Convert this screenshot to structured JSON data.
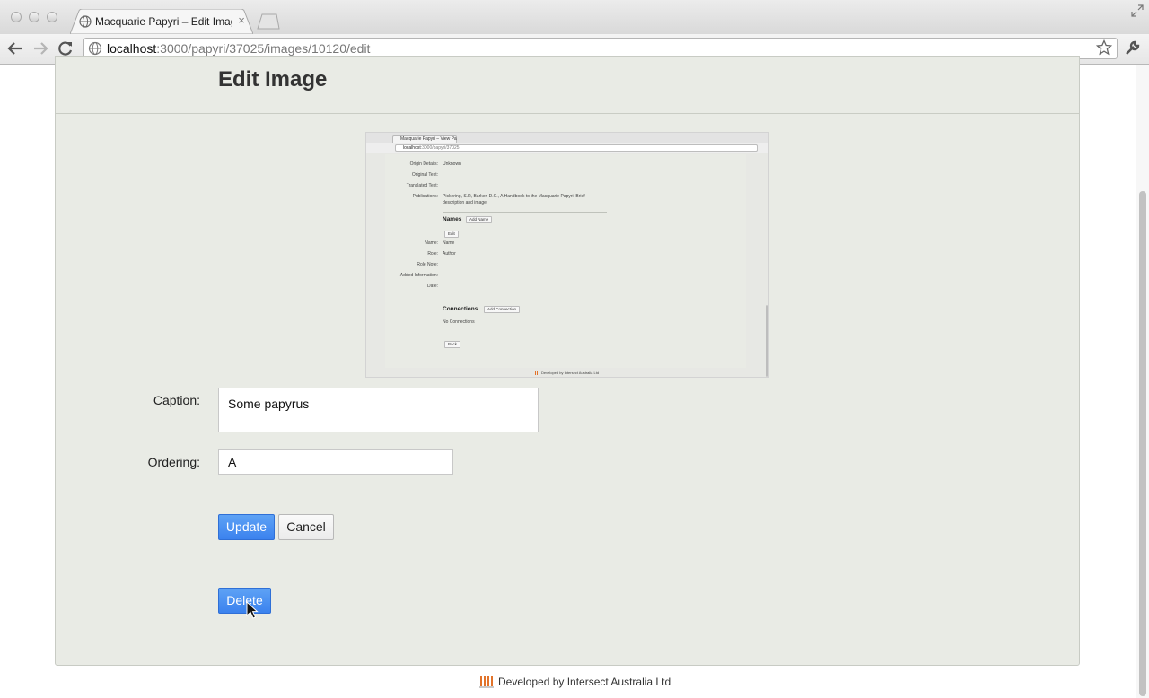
{
  "browser": {
    "tab_title": "Macquarie Papyri – Edit Imag",
    "tab_close": "×",
    "url_host": "localhost",
    "url_path": ":3000/papyri/37025/images/10120/edit"
  },
  "page": {
    "title": "Edit Image"
  },
  "image_preview": {
    "tab_title": "Macquarie Papyri – View Pa",
    "url_host": "localhost",
    "url_path": ":3000/papyri/37025",
    "fields": [
      {
        "label": "Origin Details:",
        "value": "Unknown"
      },
      {
        "label": "Original Text:",
        "value": ""
      },
      {
        "label": "Translated Text:",
        "value": ""
      },
      {
        "label": "Publications:",
        "value": "Pickering, S.R, Barker, D.C., A Handbook to the Macquarie Papyri. Brief"
      },
      {
        "label": "",
        "value": "description and image."
      }
    ],
    "names_heading": "Names",
    "add_name": "Add Name",
    "edit": "Edit",
    "name_fields": [
      {
        "label": "Name:",
        "value": "Name"
      },
      {
        "label": "Role:",
        "value": "Author"
      },
      {
        "label": "Role Note:",
        "value": ""
      },
      {
        "label": "Added Information:",
        "value": ""
      },
      {
        "label": "Date:",
        "value": ""
      }
    ],
    "connections_heading": "Connections",
    "add_connection": "Add Connection",
    "no_connections": "No Connections",
    "back": "Back",
    "footer": "Developed by Intersect Australia Ltd"
  },
  "form": {
    "caption_label": "Caption:",
    "caption_value": "Some papyrus",
    "ordering_label": "Ordering:",
    "ordering_value": "A",
    "update_label": "Update",
    "cancel_label": "Cancel",
    "delete_label": "Delete"
  },
  "footer": {
    "text": "Developed by Intersect Australia Ltd"
  },
  "colors": {
    "primary_button": "#3b82ee",
    "panel_background": "#e9ebe5",
    "logo_accent": "#e2732a"
  }
}
